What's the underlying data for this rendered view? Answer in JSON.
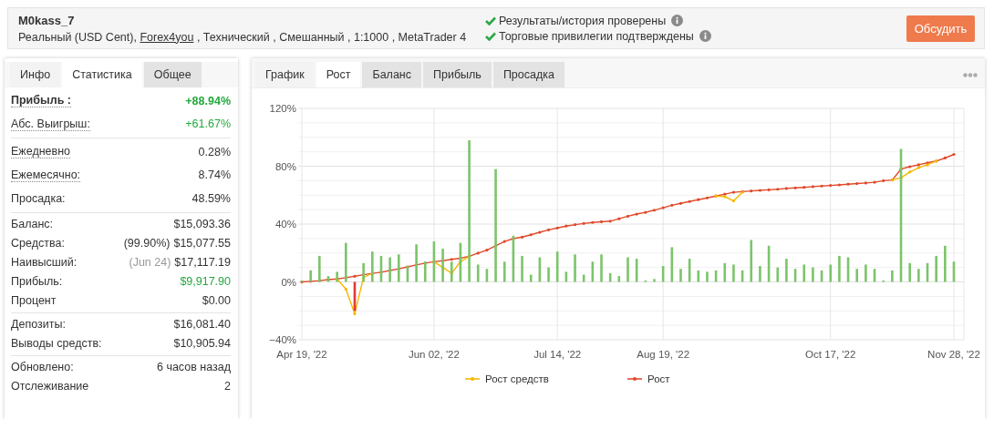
{
  "header": {
    "title": "M0kass_7",
    "subtitle": {
      "before": "Реальный (USD Cent), ",
      "link": "Forex4you",
      "after": " , Технический , Смешанный , 1:1000 , MetaTrader 4"
    },
    "checks": [
      {
        "label": "Результаты/история проверены",
        "verified": true
      },
      {
        "label": "Торговые привилегии подтверждены",
        "verified": true
      }
    ],
    "button": "Обсудить"
  },
  "stats_panel": {
    "tabs": [
      {
        "label": "Инфо",
        "selected": false
      },
      {
        "label": "Статистика",
        "selected": true
      },
      {
        "label": "Общее",
        "selected": false
      }
    ],
    "groups": [
      [
        {
          "label": "Прибыль :",
          "hint": true,
          "strong": true,
          "value": "+88.94%",
          "positive": true
        },
        {
          "label": "Абс. Выигрыш:",
          "hint": true,
          "strong": false,
          "value": "+61.67%",
          "positive": true
        }
      ],
      [
        {
          "label": "Ежедневно",
          "hint": true,
          "strong": false,
          "value": "0.28%",
          "positive": false
        },
        {
          "label": "Ежемесячно:",
          "hint": true,
          "strong": false,
          "value": "8.74%",
          "positive": false
        },
        {
          "label": "Просадка:",
          "hint": false,
          "strong": false,
          "value": "48.59%",
          "positive": false
        }
      ],
      [
        {
          "label": "Баланс:",
          "hint": false,
          "strong": false,
          "value": "$15,093.36",
          "positive": false
        },
        {
          "label": "Средства:",
          "hint": false,
          "strong": false,
          "note": "(99.90%)",
          "muted": false,
          "value": "$15,077.55",
          "positive": false
        },
        {
          "label": "Наивысший:",
          "hint": false,
          "strong": false,
          "note": "(Jun 24)",
          "muted": true,
          "value": "$17,117.19",
          "positive": false
        },
        {
          "label": "Прибыль:",
          "hint": false,
          "strong": false,
          "value": "$9,917.90",
          "positive": true
        },
        {
          "label": "Процент",
          "hint": false,
          "strong": false,
          "value": "$0.00",
          "positive": false
        }
      ],
      [
        {
          "label": "Депозиты:",
          "hint": false,
          "strong": false,
          "value": "$16,081.40",
          "positive": false
        },
        {
          "label": "Выводы средств:",
          "hint": false,
          "strong": false,
          "value": "$10,905.94",
          "positive": false
        }
      ],
      [
        {
          "label": "Обновлено:",
          "hint": false,
          "strong": false,
          "value": "6 часов назад",
          "positive": false
        },
        {
          "label": "Отслеживание",
          "hint": false,
          "strong": false,
          "value": "2",
          "positive": false
        }
      ]
    ]
  },
  "chart_panel": {
    "tabs": [
      {
        "label": "График",
        "selected": false
      },
      {
        "label": "Рост",
        "selected": true
      },
      {
        "label": "Баланс",
        "selected": false
      },
      {
        "label": "Прибыль",
        "selected": false
      },
      {
        "label": "Просадка",
        "selected": false
      }
    ],
    "chart_data": {
      "type": "line",
      "grid": true,
      "legend": "bottom",
      "ylim": [
        -40,
        120
      ],
      "yticks": [
        {
          "value": -40,
          "label": "−40%"
        },
        {
          "value": 0,
          "label": "0%"
        },
        {
          "value": 40,
          "label": "40%"
        },
        {
          "value": 80,
          "label": "80%"
        },
        {
          "value": 120,
          "label": "120%"
        }
      ],
      "categories": [
        "Apr 19, '22",
        null,
        null,
        null,
        null,
        null,
        null,
        null,
        null,
        null,
        null,
        null,
        null,
        null,
        null,
        "Jun 02, '22",
        null,
        null,
        null,
        null,
        null,
        null,
        null,
        null,
        null,
        null,
        null,
        null,
        null,
        "Jul 14, '22",
        null,
        null,
        null,
        null,
        null,
        null,
        null,
        null,
        null,
        null,
        null,
        "Aug 19, '22",
        null,
        null,
        null,
        null,
        null,
        null,
        null,
        null,
        null,
        null,
        null,
        null,
        null,
        null,
        null,
        null,
        null,
        null,
        "Oct 17, '22",
        null,
        null,
        null,
        null,
        null,
        null,
        null,
        null,
        null,
        null,
        null,
        null,
        null,
        "Nov 28, '22"
      ],
      "series": [
        {
          "type": "bar",
          "color": "#7cc46a",
          "values": [
            1,
            8,
            18,
            4,
            7,
            27,
            null,
            13,
            21,
            18,
            17,
            19,
            11,
            26,
            14,
            28,
            23,
            14,
            27,
            98,
            12,
            9,
            78,
            14,
            32,
            18,
            5,
            17,
            10,
            21,
            7,
            19,
            5,
            14,
            19,
            6,
            4,
            17,
            16,
            1,
            2,
            11,
            24,
            9,
            16,
            8,
            7,
            8,
            13,
            12,
            8,
            29,
            11,
            25,
            10,
            16,
            9,
            12,
            10,
            8,
            12,
            18,
            17,
            9,
            12,
            9,
            1,
            8,
            92,
            13,
            9,
            13,
            18,
            25,
            14
          ]
        },
        {
          "type": "bar",
          "color": "#e53935",
          "values": [
            null,
            null,
            null,
            null,
            null,
            null,
            -20,
            null,
            null,
            null,
            null,
            null,
            null,
            null,
            null,
            null,
            null,
            null,
            null,
            null,
            null,
            null,
            null,
            null,
            null,
            null,
            null,
            null,
            null,
            null,
            null,
            null,
            null,
            null,
            null,
            null,
            null,
            null,
            null,
            null,
            null,
            null,
            null,
            null,
            null,
            null,
            null,
            null,
            null,
            null,
            null,
            null,
            null,
            null,
            null,
            null,
            null,
            null,
            null,
            null,
            null,
            null,
            null,
            null,
            null,
            null,
            null,
            null,
            null,
            null,
            null,
            null,
            null,
            null,
            null
          ]
        },
        {
          "name": "Рост средств",
          "color": "#f5b800",
          "values": [
            null,
            null,
            null,
            null,
            2.1,
            -5,
            -22,
            3,
            5.9,
            null,
            null,
            null,
            null,
            null,
            null,
            13.9,
            10,
            6,
            14,
            17.7,
            null,
            null,
            null,
            null,
            null,
            null,
            null,
            null,
            null,
            null,
            null,
            null,
            null,
            null,
            null,
            null,
            null,
            null,
            null,
            null,
            null,
            null,
            null,
            null,
            null,
            null,
            null,
            59.4,
            59,
            56,
            62,
            null,
            null,
            null,
            null,
            null,
            null,
            null,
            null,
            null,
            null,
            null,
            null,
            null,
            null,
            null,
            null,
            70.5,
            72,
            76,
            79,
            81,
            83.6,
            null,
            null
          ]
        },
        {
          "name": "Рост",
          "color": "#e04a2c",
          "values": [
            0,
            0.4,
            0.9,
            1.6,
            2.1,
            2.9,
            3.9,
            5,
            5.9,
            6.7,
            7.9,
            9.1,
            10.4,
            11.7,
            13,
            13.9,
            14.7,
            15.6,
            16.4,
            17.7,
            19.9,
            22,
            25,
            28,
            29.9,
            31,
            32.6,
            34.3,
            36,
            37.3,
            38.6,
            39.6,
            40.4,
            41.1,
            41.6,
            42,
            43.7,
            45.4,
            46.9,
            48.1,
            49.6,
            51.3,
            53,
            54.3,
            55.6,
            56.9,
            58.1,
            59.4,
            60.7,
            62,
            62.4,
            62.9,
            63.3,
            63.7,
            64.1,
            64.6,
            65,
            65.4,
            65.9,
            66.3,
            66.7,
            67.1,
            67.6,
            68,
            68.4,
            68.9,
            70,
            70.5,
            78,
            79.7,
            81,
            82.3,
            83.6,
            85.7,
            88.2
          ]
        }
      ]
    }
  }
}
